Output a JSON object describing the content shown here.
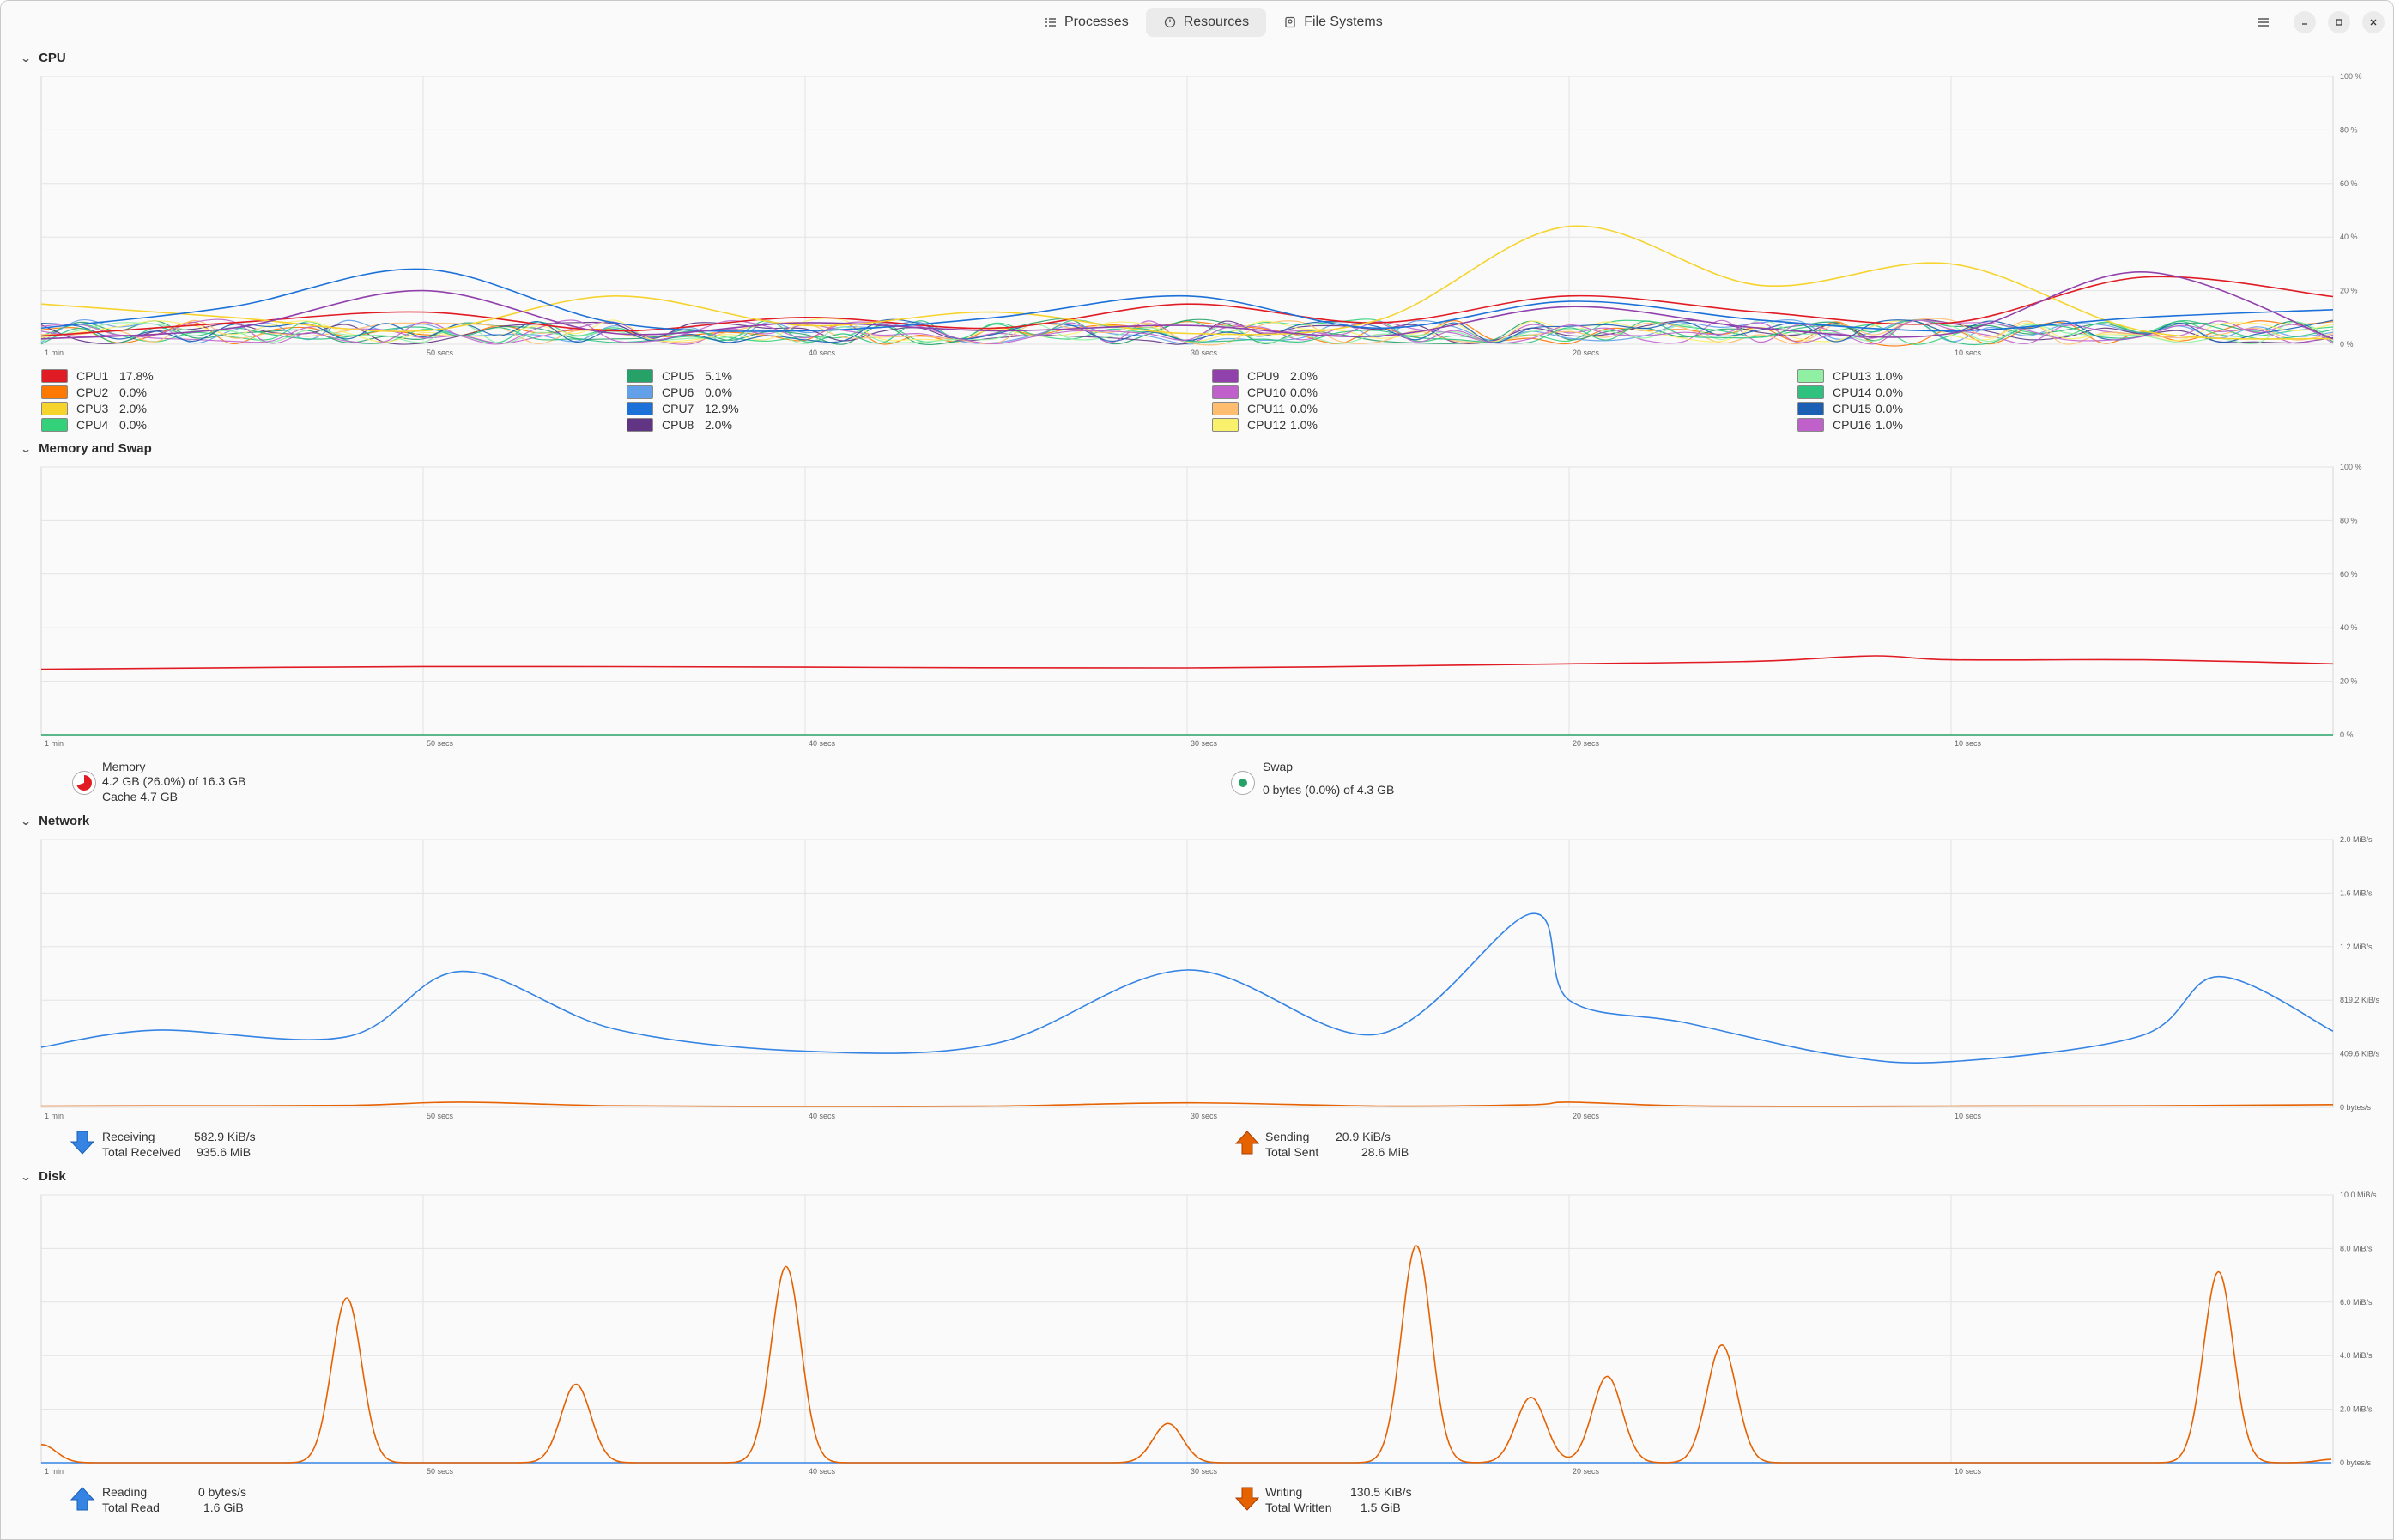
{
  "tabs": [
    {
      "label": "Processes",
      "icon": "list-icon",
      "active": false
    },
    {
      "label": "Resources",
      "icon": "gauge-icon",
      "active": true
    },
    {
      "label": "File Systems",
      "icon": "disk-icon",
      "active": false
    }
  ],
  "sections": {
    "cpu": "CPU",
    "memory": "Memory and Swap",
    "network": "Network",
    "disk": "Disk"
  },
  "x_ticks": [
    "1 min",
    "50 secs",
    "40 secs",
    "30 secs",
    "20 secs",
    "10 secs"
  ],
  "cpu": {
    "y_ticks": [
      "100 %",
      "80 %",
      "60 %",
      "40 %",
      "20 %",
      "0 %"
    ],
    "legend": [
      {
        "name": "CPU1",
        "value": "17.8%",
        "color": "#e01b24"
      },
      {
        "name": "CPU2",
        "value": "0.0%",
        "color": "#ff7800"
      },
      {
        "name": "CPU3",
        "value": "2.0%",
        "color": "#f6d32d"
      },
      {
        "name": "CPU4",
        "value": "0.0%",
        "color": "#33d17a"
      },
      {
        "name": "CPU5",
        "value": "5.1%",
        "color": "#26a269"
      },
      {
        "name": "CPU6",
        "value": "0.0%",
        "color": "#62a0ea"
      },
      {
        "name": "CPU7",
        "value": "12.9%",
        "color": "#1c71d8"
      },
      {
        "name": "CPU8",
        "value": "2.0%",
        "color": "#613583"
      },
      {
        "name": "CPU9",
        "value": "2.0%",
        "color": "#9141ac"
      },
      {
        "name": "CPU10",
        "value": "0.0%",
        "color": "#c061cb"
      },
      {
        "name": "CPU11",
        "value": "0.0%",
        "color": "#ffbe6f"
      },
      {
        "name": "CPU12",
        "value": "1.0%",
        "color": "#f9f06b"
      },
      {
        "name": "CPU13",
        "value": "1.0%",
        "color": "#8ff0a4"
      },
      {
        "name": "CPU14",
        "value": "0.0%",
        "color": "#2ec27e"
      },
      {
        "name": "CPU15",
        "value": "0.0%",
        "color": "#1a5fb4"
      },
      {
        "name": "CPU16",
        "value": "1.0%",
        "color": "#c061cb"
      }
    ]
  },
  "memory": {
    "y_ticks": [
      "100 %",
      "80 %",
      "60 %",
      "40 %",
      "20 %",
      "0 %"
    ],
    "memory_label": "Memory",
    "memory_value": "4.2 GB (26.0%) of 16.3 GB",
    "cache_value": "Cache 4.7 GB",
    "swap_label": "Swap",
    "swap_value": "0 bytes (0.0%) of 4.3 GB",
    "memory_color": "#e01b24",
    "swap_color": "#26a269"
  },
  "network": {
    "y_ticks": [
      "2.0 MiB/s",
      "1.6 MiB/s",
      "1.2 MiB/s",
      "819.2 KiB/s",
      "409.6 KiB/s",
      "0 bytes/s"
    ],
    "receiving_label": "Receiving",
    "receiving_value": "582.9 KiB/s",
    "total_received_label": "Total Received",
    "total_received_value": "935.6 MiB",
    "sending_label": "Sending",
    "sending_value": "20.9 KiB/s",
    "total_sent_label": "Total Sent",
    "total_sent_value": "28.6 MiB",
    "receive_color": "#3584e4",
    "send_color": "#e66100"
  },
  "disk": {
    "y_ticks": [
      "10.0 MiB/s",
      "8.0 MiB/s",
      "6.0 MiB/s",
      "4.0 MiB/s",
      "2.0 MiB/s",
      "0 bytes/s"
    ],
    "reading_label": "Reading",
    "reading_value": "0 bytes/s",
    "total_read_label": "Total Read",
    "total_read_value": "1.6 GiB",
    "writing_label": "Writing",
    "writing_value": "130.5 KiB/s",
    "total_written_label": "Total Written",
    "total_written_value": "1.5 GiB",
    "read_color": "#3584e4",
    "write_color": "#e66100"
  },
  "chart_data": [
    {
      "type": "line",
      "title": "CPU",
      "ylim": [
        0,
        100
      ],
      "x": [
        60,
        55,
        50,
        45,
        40,
        35,
        30,
        25,
        20,
        15,
        10,
        5,
        0
      ],
      "series": [
        {
          "name": "CPU1",
          "values": [
            3,
            8,
            12,
            5,
            10,
            6,
            15,
            8,
            18,
            12,
            8,
            25,
            17.8
          ]
        },
        {
          "name": "CPU3",
          "values": [
            15,
            10,
            5,
            18,
            7,
            12,
            4,
            9,
            44,
            22,
            30,
            5,
            2
          ]
        },
        {
          "name": "CPU7",
          "values": [
            6,
            14,
            28,
            8,
            5,
            10,
            18,
            6,
            16,
            9,
            5,
            10,
            12.9
          ]
        },
        {
          "name": "CPU9",
          "values": [
            2,
            6,
            20,
            4,
            8,
            5,
            7,
            3,
            14,
            6,
            4,
            27,
            2
          ]
        }
      ]
    },
    {
      "type": "line",
      "title": "Memory and Swap",
      "ylim": [
        0,
        100
      ],
      "x": [
        60,
        50,
        40,
        30,
        20,
        15,
        12,
        10,
        5,
        0
      ],
      "series": [
        {
          "name": "Memory",
          "values": [
            24.5,
            25.5,
            25.3,
            25,
            26.5,
            27.5,
            29.5,
            28,
            28,
            26.5
          ]
        },
        {
          "name": "Swap",
          "values": [
            0,
            0,
            0,
            0,
            0,
            0,
            0,
            0,
            0,
            0
          ]
        }
      ]
    },
    {
      "type": "line",
      "title": "Network",
      "ylim": [
        0,
        2048
      ],
      "x": [
        60,
        57,
        52,
        49,
        45,
        40,
        35,
        30,
        25,
        21,
        20,
        17,
        13,
        10,
        5,
        3,
        0
      ],
      "series": [
        {
          "name": "Receiving",
          "values": [
            460,
            590,
            540,
            1040,
            600,
            430,
            490,
            1050,
            560,
            1480,
            820,
            650,
            400,
            350,
            550,
            1000,
            583
          ]
        },
        {
          "name": "Sending",
          "values": [
            10,
            12,
            15,
            40,
            12,
            8,
            10,
            35,
            10,
            20,
            40,
            12,
            8,
            10,
            12,
            15,
            21
          ]
        }
      ]
    },
    {
      "type": "line",
      "title": "Disk",
      "ylim": [
        0,
        10240
      ],
      "x": [
        60,
        57,
        52,
        46,
        40.5,
        35,
        30.5,
        26,
        24,
        21,
        19,
        16,
        10,
        3,
        0
      ],
      "series": [
        {
          "name": "Reading",
          "values": [
            0,
            0,
            0,
            0,
            0,
            0,
            0,
            0,
            0,
            0,
            1,
            0,
            0,
            0,
            0
          ]
        },
        {
          "name": "Writing",
          "values": [
            700,
            0,
            6300,
            3000,
            7500,
            0,
            1500,
            0,
            8300,
            2500,
            3300,
            4500,
            0,
            7300,
            130
          ]
        }
      ]
    }
  ]
}
